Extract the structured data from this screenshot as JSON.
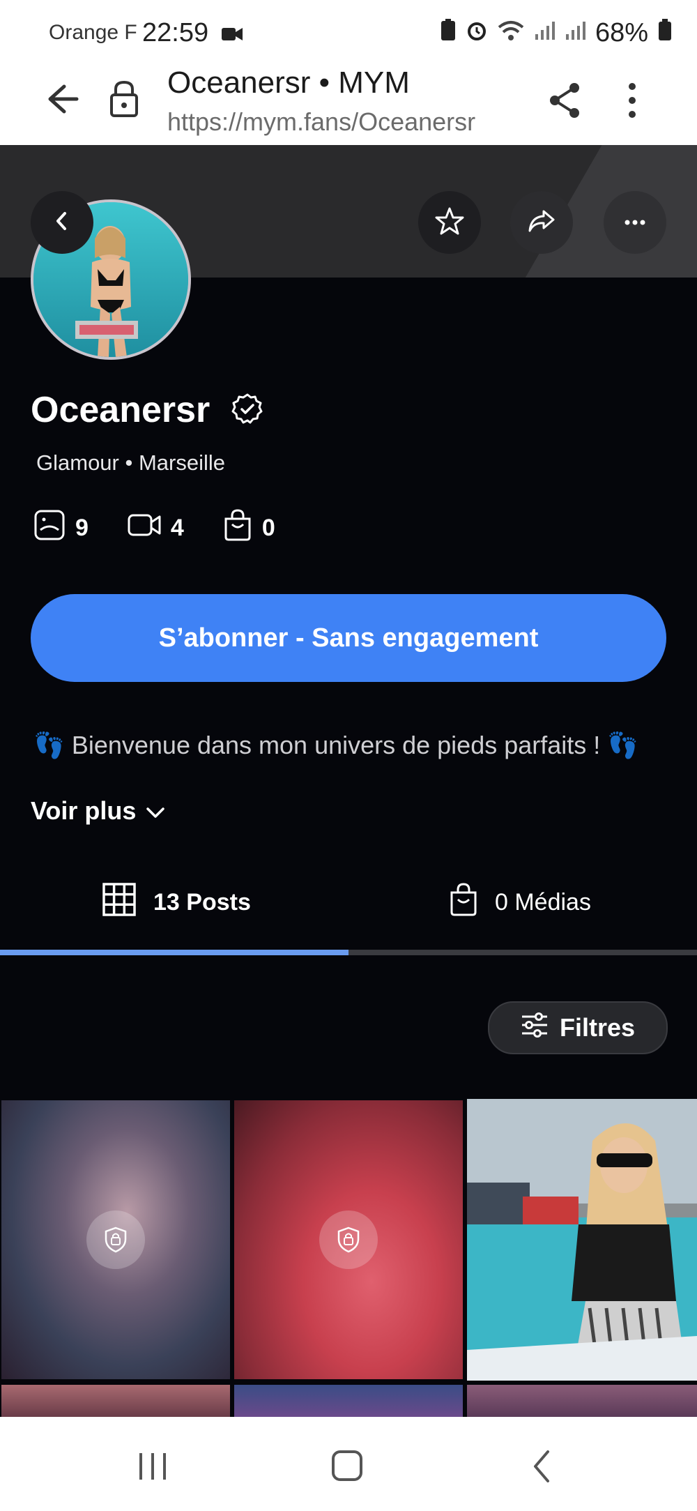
{
  "status_bar": {
    "carrier": "Orange F",
    "time": "22:59",
    "battery": "68%"
  },
  "browser": {
    "page_title": "Oceanersr • MYM",
    "url": "https://mym.fans/Oceanersr"
  },
  "profile": {
    "name": "Oceanersr",
    "category": "Glamour • Marseille",
    "stats": {
      "photos": "9",
      "videos": "4",
      "shop": "0"
    },
    "subscribe_label": "S’abonner - Sans engagement",
    "bio": "👣 Bienvenue dans mon univers de pieds parfaits ! 👣",
    "see_more": "Voir plus"
  },
  "tabs": [
    {
      "label": "13 Posts",
      "active": true
    },
    {
      "label": "0 Médias",
      "active": false
    }
  ],
  "filters_label": "Filtres",
  "colors": {
    "accent": "#3f82f5",
    "background": "#05060b",
    "tab_indicator": "#6a9cf0"
  },
  "icons": {
    "back": "arrow-left-icon",
    "lock": "lock-icon",
    "share": "share-icon",
    "menu": "more-vertical-icon",
    "star": "star-icon",
    "forward": "forward-icon",
    "more": "more-horizontal-icon",
    "verified": "verified-badge-icon",
    "photo": "photo-icon",
    "video": "video-icon",
    "bag": "shopping-bag-icon",
    "grid": "grid-icon",
    "filters": "sliders-icon"
  }
}
